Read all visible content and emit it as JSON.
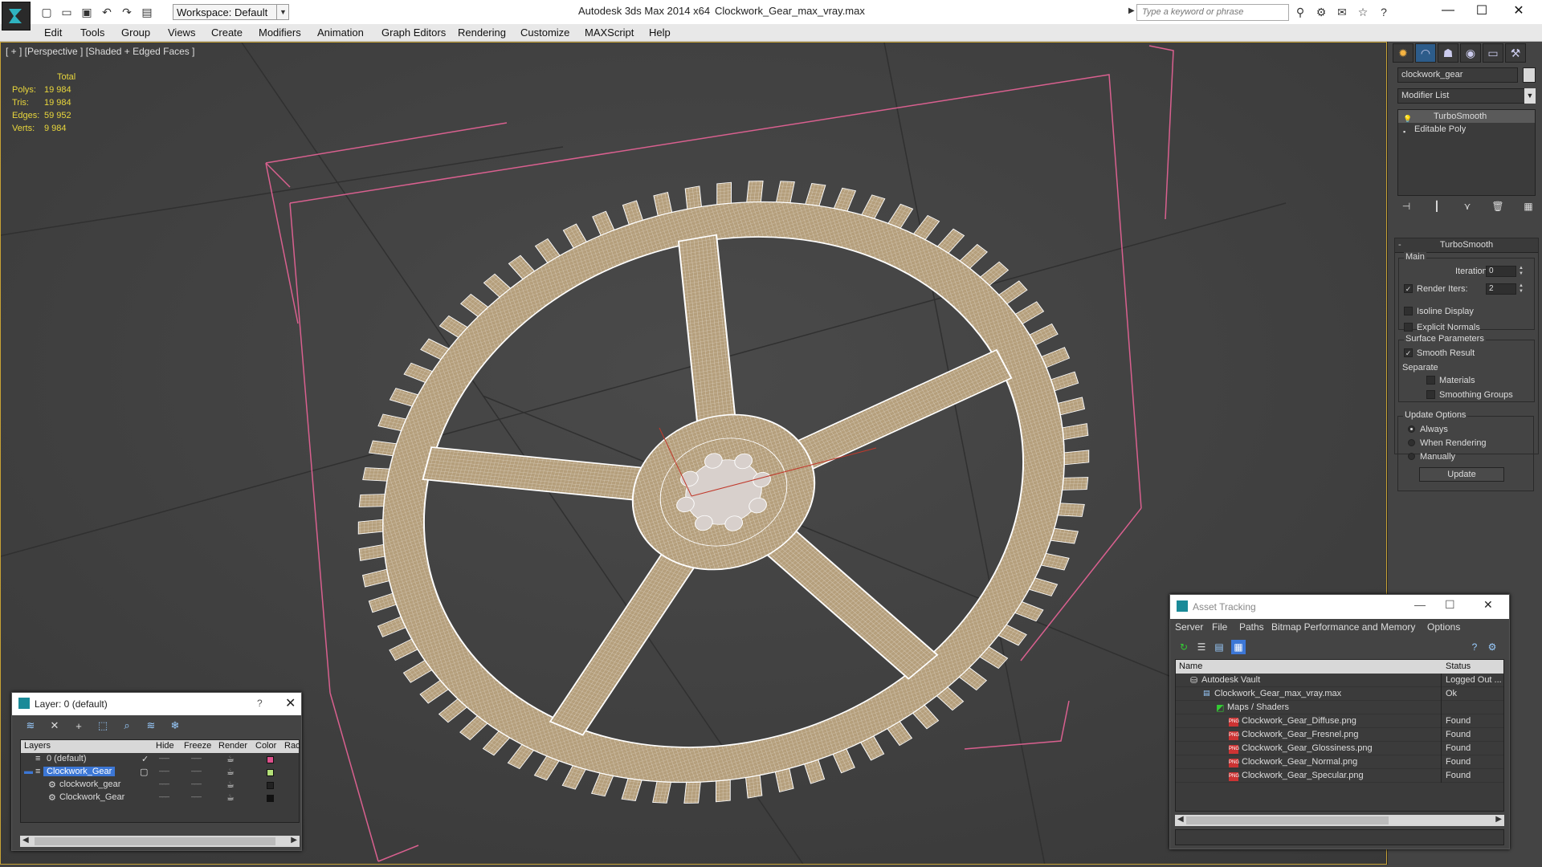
{
  "titlebar": {
    "workspace": "Workspace: Default",
    "app_title": "Autodesk 3ds Max  2014 x64",
    "file_title": "Clockwork_Gear_max_vray.max",
    "search_placeholder": "Type a keyword or phrase"
  },
  "menu": [
    "Edit",
    "Tools",
    "Group",
    "Views",
    "Create",
    "Modifiers",
    "Animation",
    "Graph Editors",
    "Rendering",
    "Customize",
    "MAXScript",
    "Help"
  ],
  "viewport": {
    "label": "[ + ] [Perspective ] [Shaded + Edged Faces ]",
    "stats_header": "Total",
    "stats": [
      {
        "label": "Polys:",
        "value": "19 984"
      },
      {
        "label": "Tris:",
        "value": "19 984"
      },
      {
        "label": "Edges:",
        "value": "59 952"
      },
      {
        "label": "Verts:",
        "value": "9 984"
      }
    ]
  },
  "command_panel": {
    "object_name": "clockwork_gear",
    "modifier_list": "Modifier List",
    "stack": [
      "TurboSmooth",
      "Editable Poly"
    ],
    "rollout_title": "TurboSmooth",
    "main_group": "Main",
    "iterations_label": "Iterations:",
    "iterations_value": "0",
    "render_iters_label": "Render Iters:",
    "render_iters_value": "2",
    "isoline_display": "Isoline Display",
    "explicit_normals": "Explicit Normals",
    "surface_params": "Surface Parameters",
    "smooth_result": "Smooth Result",
    "separate": "Separate",
    "materials": "Materials",
    "smoothing_groups": "Smoothing Groups",
    "update_options": "Update Options",
    "always": "Always",
    "when_rendering": "When Rendering",
    "manually": "Manually",
    "update_button": "Update"
  },
  "layer_window": {
    "title": "Layer: 0 (default)",
    "help": "?",
    "columns": {
      "layers": "Layers",
      "hide": "Hide",
      "freeze": "Freeze",
      "render": "Render",
      "color": "Color",
      "rad": "Rac"
    },
    "rows": [
      {
        "name": "0 (default)",
        "color": "#e0508c"
      },
      {
        "name": "Clockwork_Gear",
        "color": "#b4e078"
      },
      {
        "name": "clockwork_gear",
        "color": "#222222"
      },
      {
        "name": "Clockwork_Gear",
        "color": "#111111"
      }
    ]
  },
  "asset_window": {
    "title": "Asset Tracking",
    "menu": [
      "Server",
      "File",
      "Paths",
      "Bitmap Performance and Memory",
      "Options"
    ],
    "columns": {
      "name": "Name",
      "status": "Status"
    },
    "rows": [
      {
        "name": "Autodesk Vault",
        "status": "Logged Out ..."
      },
      {
        "name": "Clockwork_Gear_max_vray.max",
        "status": "Ok"
      },
      {
        "name": "Maps / Shaders",
        "status": ""
      },
      {
        "name": "Clockwork_Gear_Diffuse.png",
        "status": "Found"
      },
      {
        "name": "Clockwork_Gear_Fresnel.png",
        "status": "Found"
      },
      {
        "name": "Clockwork_Gear_Glossiness.png",
        "status": "Found"
      },
      {
        "name": "Clockwork_Gear_Normal.png",
        "status": "Found"
      },
      {
        "name": "Clockwork_Gear_Specular.png",
        "status": "Found"
      }
    ]
  }
}
